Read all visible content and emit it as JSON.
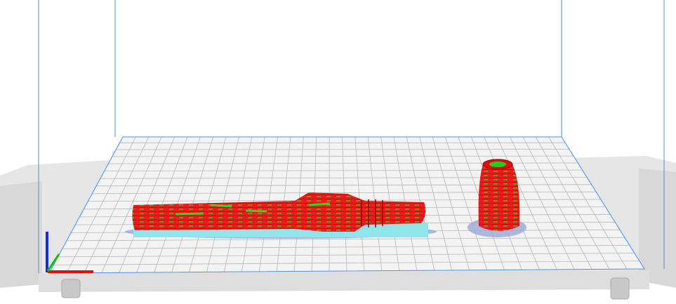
{
  "viewport": {
    "view_mode": "layer-view",
    "colors": {
      "background": "#ffffff",
      "build_volume_edge": "#4a8fe8",
      "plate": "#f0f0f0",
      "grid": "#b8b8b8",
      "frame": "#dcdcdc",
      "model_wall": "#ee1c1c",
      "model_infill": "#22dd22",
      "support": "#8fe6ea",
      "skirt": "#9aa8d8",
      "axis_x": "#e01010",
      "axis_y": "#1030e0",
      "axis_z": "#10c010"
    }
  }
}
